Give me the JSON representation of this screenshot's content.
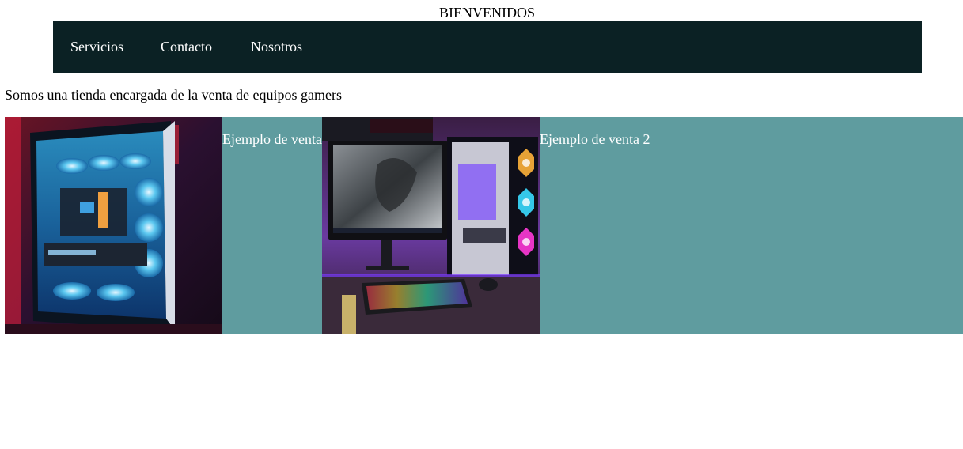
{
  "header": {
    "title": "BIENVENIDOS"
  },
  "nav": {
    "items": [
      {
        "label": "Servicios"
      },
      {
        "label": "Contacto"
      },
      {
        "label": "Nosotros"
      }
    ],
    "background": "#0b2124",
    "text_color": "#ffffff"
  },
  "main": {
    "intro": "Somos una tienda encargada de la venta de equipos gamers",
    "showcase_background": "#5f9c9f",
    "products": [
      {
        "caption": "Ejemplo de venta",
        "image": "gaming-pc-case-photo"
      },
      {
        "caption": "Ejemplo de venta 2",
        "image": "gaming-setup-photo"
      }
    ]
  }
}
